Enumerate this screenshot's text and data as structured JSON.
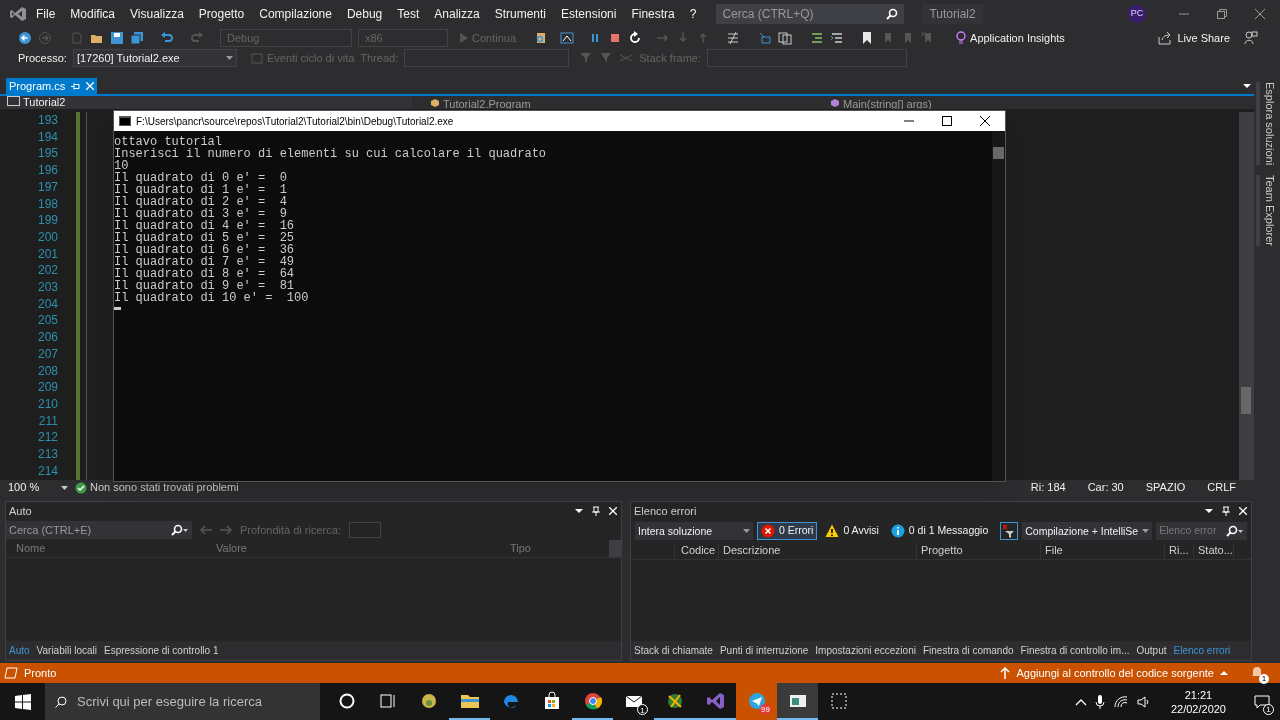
{
  "ide": {
    "solution": "Tutorial2",
    "search": {
      "placeholder": "Cerca (CTRL+Q)"
    },
    "user_initials": "PC"
  },
  "menu": [
    "File",
    "Modifica",
    "Visualizza",
    "Progetto",
    "Compilazione",
    "Debug",
    "Test",
    "Analizza",
    "Strumenti",
    "Estensioni",
    "Finestra",
    "?"
  ],
  "toolbar": {
    "configuration": "Debug",
    "platform": "x86",
    "continue": "Continua",
    "app_insights": "Application Insights",
    "live_share": "Live Share"
  },
  "debug_bar": {
    "process_label": "Processo:",
    "process": "[17260] Tutorial2.exe",
    "lifecycle": "Eventi ciclo di vita",
    "thread_label": "Thread:",
    "stack_label": "Stack frame:"
  },
  "document_tabs": [
    {
      "label": "Program.cs",
      "selected": true
    }
  ],
  "nav_bar": {
    "project": "Tutorial2",
    "class": "Tutorial2.Program",
    "member": "Main(string[] args)"
  },
  "editor": {
    "line_numbers": [
      "193",
      "194",
      "195",
      "196",
      "197",
      "198",
      "199",
      "200",
      "201",
      "202",
      "203",
      "204",
      "205",
      "206",
      "207",
      "208",
      "209",
      "210",
      "211",
      "212",
      "213",
      "214"
    ],
    "zoom": "100 %",
    "status": "Non sono stati trovati problemi",
    "position": [
      "Ri: 184",
      "Car: 30",
      "SPAZIO",
      "CRLF"
    ]
  },
  "side_tabs": [
    "Esplora soluzioni",
    "Team Explorer"
  ],
  "console": {
    "title": "F:\\Users\\pancr\\source\\repos\\Tutorial2\\Tutorial2\\bin\\Debug\\Tutorial2.exe",
    "lines": [
      "ottavo tutorial",
      "Inserisci il numero di elementi su cui calcolare il quadrato",
      "10",
      "Il quadrato di 0 e' =  0",
      "Il quadrato di 1 e' =  1",
      "Il quadrato di 2 e' =  4",
      "Il quadrato di 3 e' =  9",
      "Il quadrato di 4 e' =  16",
      "Il quadrato di 5 e' =  25",
      "Il quadrato di 6 e' =  36",
      "Il quadrato di 7 e' =  49",
      "Il quadrato di 8 e' =  64",
      "Il quadrato di 9 e' =  81",
      "Il quadrato di 10 e' =  100"
    ]
  },
  "auto_panel": {
    "title": "Auto",
    "search": {
      "placeholder": "Cerca (CTRL+E)"
    },
    "depth_label": "Profondità di ricerca:",
    "columns": [
      "Nome",
      "Valore",
      "Tipo"
    ],
    "tabs": [
      {
        "label": "Auto",
        "selected": true
      },
      {
        "label": "Variabili locali",
        "selected": false
      },
      {
        "label": "Espressione di controllo 1",
        "selected": false
      }
    ]
  },
  "error_list": {
    "title": "Elenco errori",
    "scope": "Intera soluzione",
    "filters": [
      {
        "kind": "error",
        "label": "0 Errori",
        "selected": true
      },
      {
        "kind": "warning",
        "label": "0 Avvisi",
        "selected": false
      },
      {
        "kind": "info",
        "label": "0 di 1 Messaggio",
        "selected": false
      }
    ],
    "build_filter": "Compilazione + IntelliSe",
    "search": {
      "placeholder": "Elenco error"
    },
    "columns": [
      "Codice",
      "Descrizione",
      "Progetto",
      "File",
      "Ri...",
      "Stato..."
    ],
    "tabs": [
      {
        "label": "Stack di chiamate",
        "selected": false
      },
      {
        "label": "Punti di interruzione",
        "selected": false
      },
      {
        "label": "Impostazioni eccezioni",
        "selected": false
      },
      {
        "label": "Finestra di comando",
        "selected": false
      },
      {
        "label": "Finestra di controllo im...",
        "selected": false
      },
      {
        "label": "Output",
        "selected": false
      },
      {
        "label": "Elenco errori",
        "selected": true
      }
    ]
  },
  "status_bar": {
    "text": "Pronto",
    "source_control": "Aggiungi al controllo del codice sorgente",
    "notifications": "1"
  },
  "taskbar": {
    "search": {
      "placeholder": "Scrivi qui per eseguire la ricerca"
    },
    "apps": [
      {
        "kind": "cortana",
        "running": false,
        "focused": false,
        "flashing": false
      },
      {
        "kind": "taskview",
        "running": false,
        "focused": false,
        "flashing": false
      },
      {
        "kind": "game",
        "running": false,
        "focused": false,
        "flashing": false
      },
      {
        "kind": "explorer",
        "running": true,
        "focused": false,
        "flashing": false
      },
      {
        "kind": "edge",
        "running": false,
        "focused": false,
        "flashing": false
      },
      {
        "kind": "store",
        "running": false,
        "focused": false,
        "flashing": false
      },
      {
        "kind": "chrome",
        "running": true,
        "focused": false,
        "flashing": false
      },
      {
        "kind": "mail",
        "running": false,
        "focused": false,
        "flashing": false,
        "badge": "1"
      },
      {
        "kind": "globe",
        "running": true,
        "focused": false,
        "flashing": false
      },
      {
        "kind": "vs",
        "running": true,
        "focused": false,
        "flashing": false
      },
      {
        "kind": "telegram",
        "running": true,
        "focused": false,
        "flashing": true,
        "badge": "99"
      },
      {
        "kind": "remote",
        "running": true,
        "focused": true,
        "flashing": false
      },
      {
        "kind": "snip",
        "running": false,
        "focused": false,
        "flashing": false
      }
    ],
    "time": "21:21",
    "date": "22/02/2020",
    "notifications": "1"
  }
}
